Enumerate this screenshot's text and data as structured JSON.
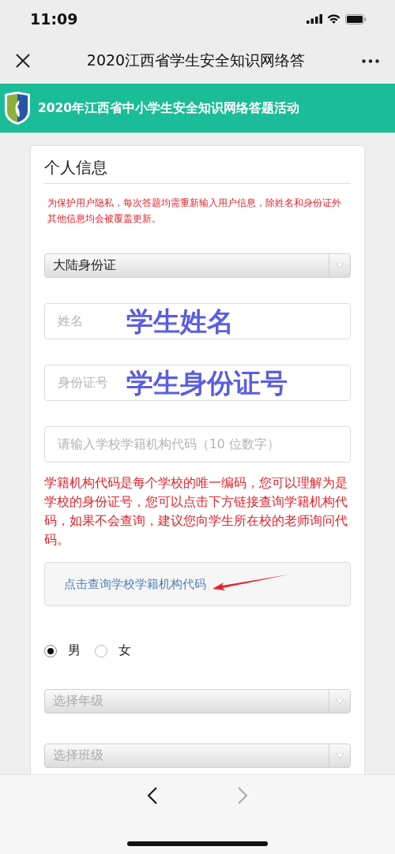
{
  "status_bar": {
    "time": "11:09"
  },
  "nav": {
    "title": "2020江西省学生安全知识网络答"
  },
  "banner": {
    "title": "2020年江西省中小学生安全知识网络答题活动"
  },
  "form": {
    "heading": "个人信息",
    "privacy_note": "为保护用户隐私，每次答题均需重新输入用户信息，除姓名和身份证外其他信息均会被覆盖更新。",
    "id_type": {
      "value": "大陆身份证"
    },
    "fields": [
      {
        "placeholder": "姓名",
        "annotation": "学生姓名"
      },
      {
        "placeholder": "身份证号",
        "annotation": "学生身份证号"
      },
      {
        "placeholder": "请输入学校学籍机构代码（10 位数字）"
      }
    ],
    "code_note": "学籍机构代码是每个学校的唯一编码，您可以理解为是学校的身份证号，您可以点击下方链接查询学籍机构代码，如果不会查询，建议您向学生所在校的老师询问代码。",
    "lookup_link": "点击查询学校学籍机构代码",
    "gender": [
      {
        "label": "男",
        "selected": true
      },
      {
        "label": "女",
        "selected": false
      }
    ],
    "selects": [
      {
        "placeholder": "选择年级"
      },
      {
        "placeholder": "选择班级"
      }
    ]
  }
}
